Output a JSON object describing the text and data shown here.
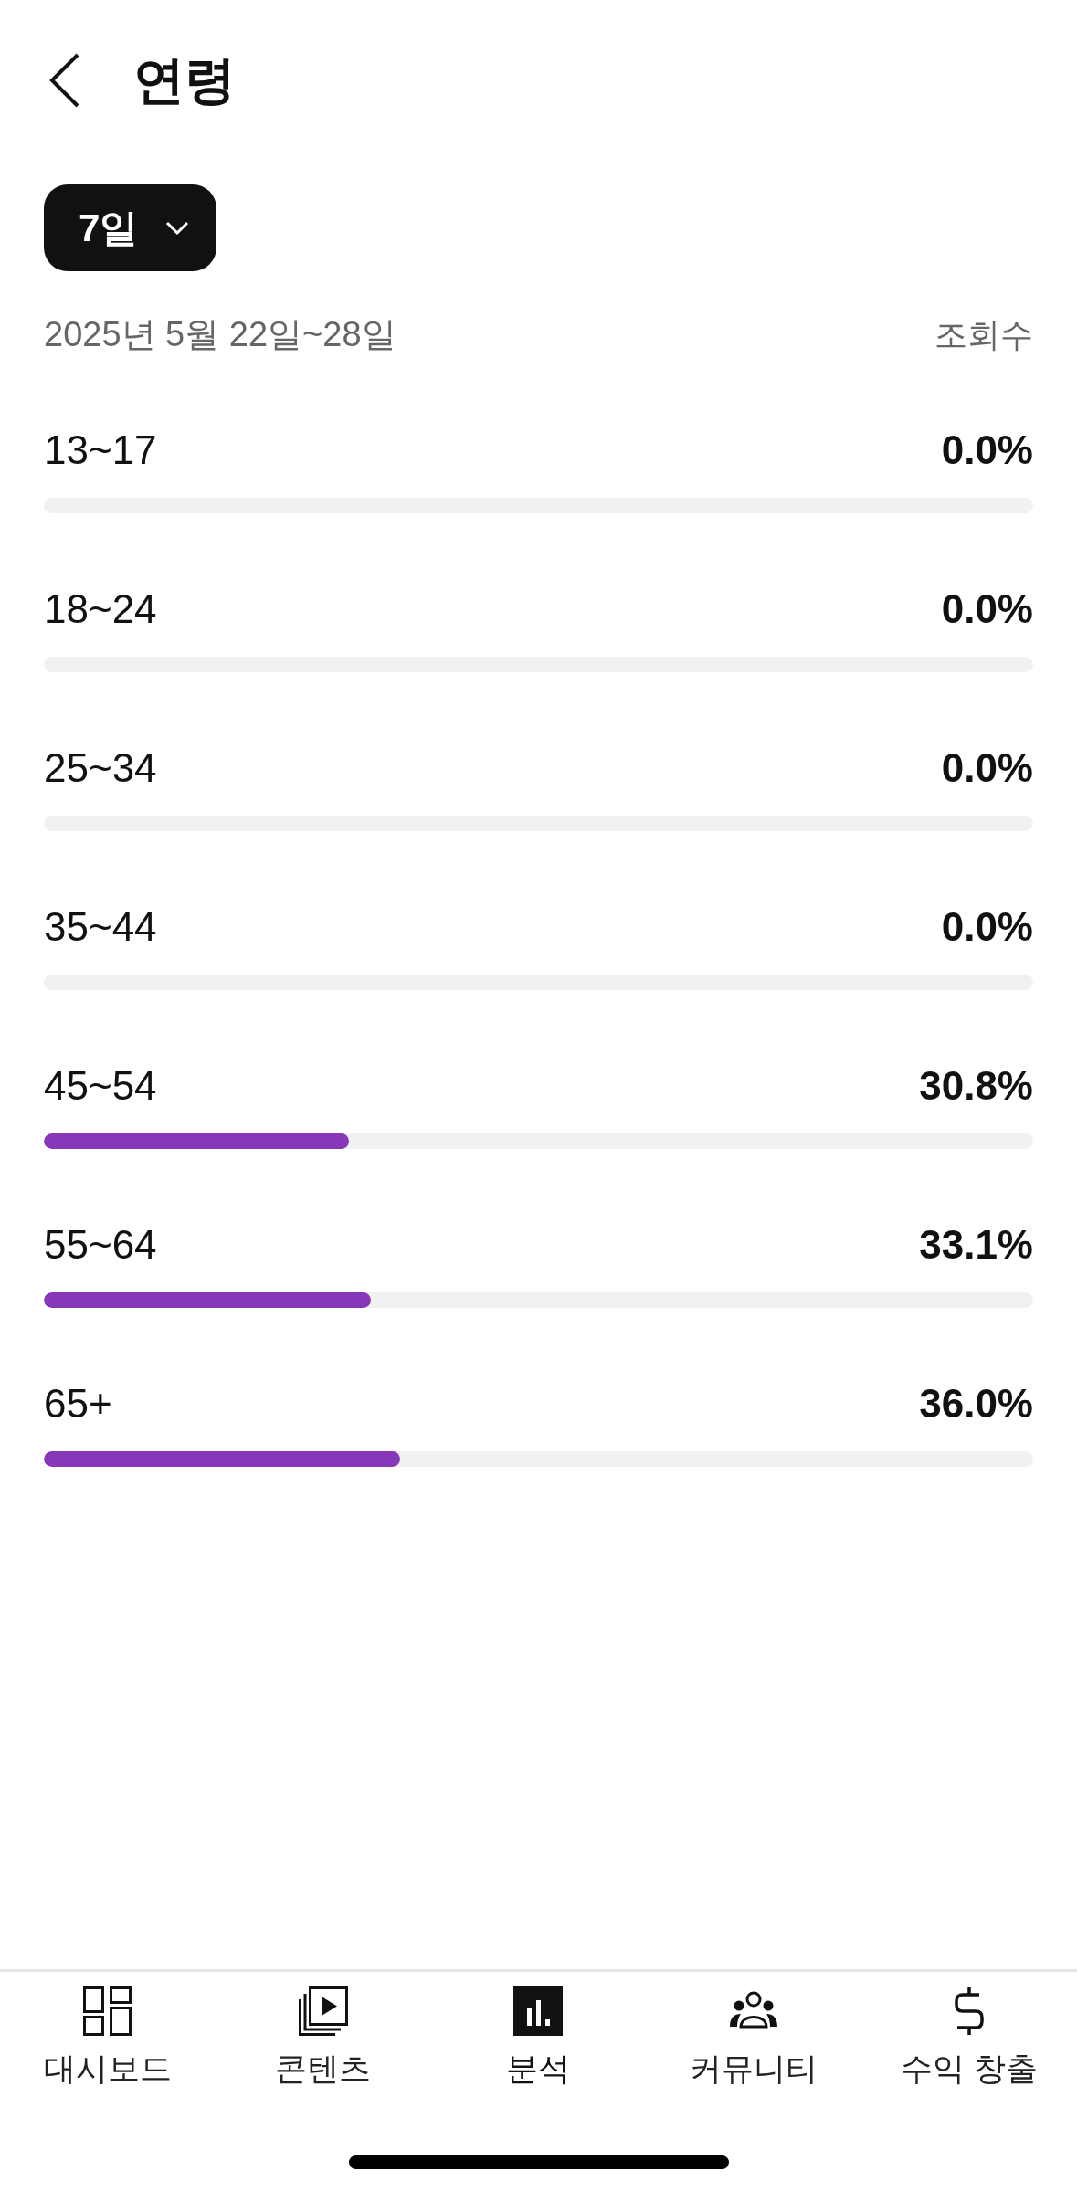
{
  "header": {
    "title": "연령"
  },
  "period_dropdown": {
    "label": "7일"
  },
  "date_range": "2025년 5월 22일~28일",
  "metric": "조회수",
  "age_groups": [
    {
      "label": "13~17",
      "value": "0.0%"
    },
    {
      "label": "18~24",
      "value": "0.0%"
    },
    {
      "label": "25~34",
      "value": "0.0%"
    },
    {
      "label": "35~44",
      "value": "0.0%"
    },
    {
      "label": "45~54",
      "value": "30.8%",
      "level": 0.308
    },
    {
      "label": "55~64",
      "value": "33.1%",
      "level": 0.331
    },
    {
      "label": "65+",
      "value": "36.0%",
      "level": 0.36
    }
  ],
  "bottom_nav": [
    {
      "label": "대시보드",
      "kind": "dashboard",
      "selected": false
    },
    {
      "label": "콘텐츠",
      "kind": "content",
      "selected": false
    },
    {
      "label": "분석",
      "kind": "analytics",
      "selected": true
    },
    {
      "label": "커뮤니티",
      "kind": "community",
      "selected": false
    },
    {
      "label": "수익 창출",
      "kind": "earn",
      "selected": false
    }
  ]
}
